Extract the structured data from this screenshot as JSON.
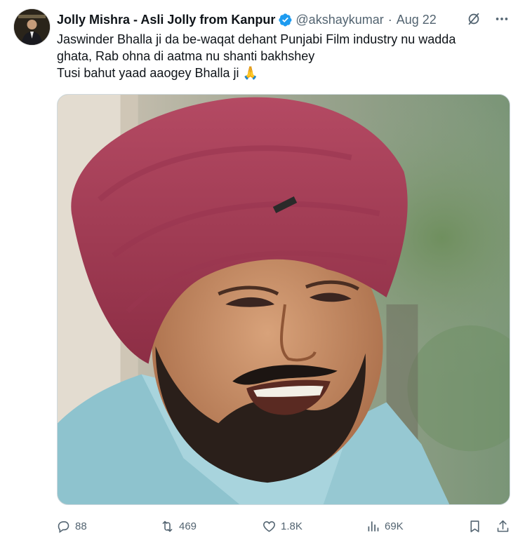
{
  "tweet": {
    "author_name": "Jolly Mishra - Asli Jolly from Kanpur",
    "handle": "@akshaykumar",
    "separator": "·",
    "date": "Aug 22",
    "text_lines": [
      "Jaswinder Bhalla ji da be-waqat dehant Punjabi Film industry nu wadda",
      "ghata, Rab ohna di aatma nu shanti bakhshey",
      "Tusi bahut yaad aaogey Bhalla ji 🙏"
    ]
  },
  "actions": {
    "replies": "88",
    "reposts": "469",
    "likes": "1.8K",
    "views": "69K"
  },
  "colors": {
    "text": "#0f1419",
    "secondary": "#536471",
    "verified": "#1d9bf0",
    "border": "#cfd9de"
  },
  "icons": [
    "verified-badge-icon",
    "grok-icon",
    "more-icon",
    "reply-icon",
    "repost-icon",
    "like-icon",
    "views-icon",
    "bookmark-icon",
    "share-icon"
  ]
}
